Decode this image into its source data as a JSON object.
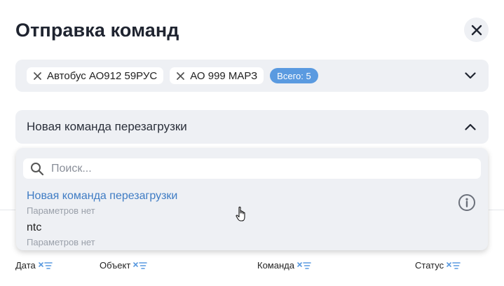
{
  "modal": {
    "title": "Отправка команд"
  },
  "vehicles": {
    "chips": [
      {
        "label": "Автобус АО912 59РУС"
      },
      {
        "label": "АО 999 МАРЗ"
      }
    ],
    "total_label": "Всего: 5"
  },
  "command": {
    "selected_value": "Новая команда перезагрузки"
  },
  "dropdown": {
    "search_placeholder": "Поиск...",
    "options": [
      {
        "label": "Новая команда перезагрузки",
        "sub": "Параметров нет"
      },
      {
        "label": "ntc",
        "sub": "Параметров нет"
      }
    ]
  },
  "table": {
    "columns": [
      {
        "label": "Дата"
      },
      {
        "label": "Объект"
      },
      {
        "label": "Команда"
      },
      {
        "label": "Статус"
      }
    ]
  },
  "colors": {
    "accent": "#5a9ae0",
    "link": "#3f7cc4",
    "field_bg": "#eef0f4"
  },
  "icons": {
    "close": "close-icon",
    "chip_remove": "x-icon",
    "expand": "chevron-down-icon",
    "collapse": "chevron-up-icon",
    "search": "search-icon",
    "info": "info-icon",
    "filter_sort": "filter-sort-icon"
  }
}
